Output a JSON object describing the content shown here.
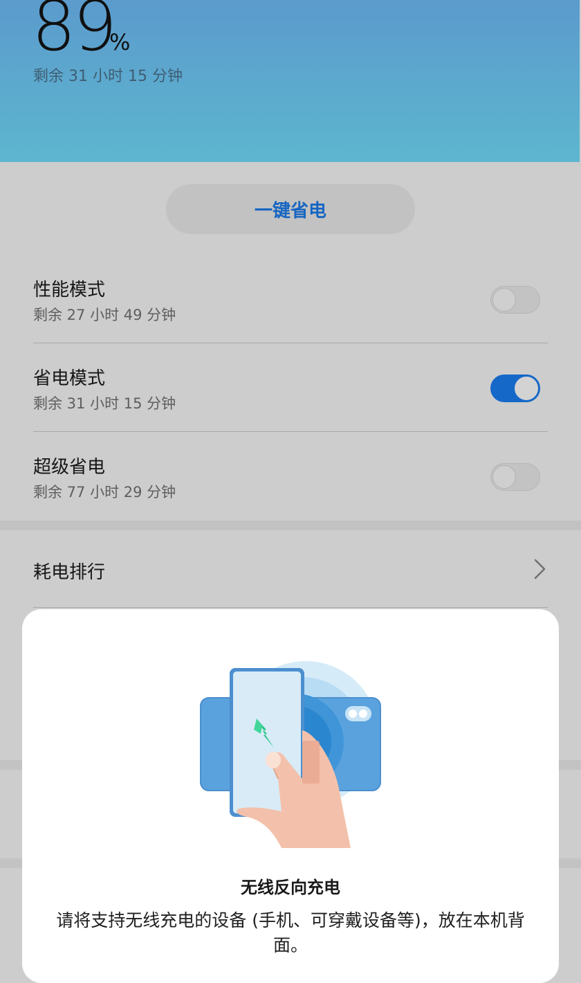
{
  "battery": {
    "percent": "89",
    "percent_sign": "%",
    "remaining": "剩余 31 小时 15 分钟"
  },
  "one_tap_save_label": "一键省电",
  "modes": [
    {
      "title": "性能模式",
      "remaining": "剩余 27 小时 49 分钟",
      "enabled": false
    },
    {
      "title": "省电模式",
      "remaining": "剩余 31 小时 15 分钟",
      "enabled": true
    },
    {
      "title": "超级省电",
      "remaining": "剩余 77 小时 29 分钟",
      "enabled": false
    }
  ],
  "usage_ranking_label": "耗电排行",
  "dialog": {
    "title": "无线反向充电",
    "description": "请将支持无线充电的设备 (手机、可穿戴设备等)，放在本机背面。"
  },
  "colors": {
    "accent": "#1668c8",
    "header_top": "#5b9bcd",
    "header_bottom": "#5db6cf",
    "bolt_green": "#2fc88a"
  },
  "icons": {
    "chevron": "chevron-right-icon",
    "illustration": "wireless-reverse-charging-illustration"
  }
}
